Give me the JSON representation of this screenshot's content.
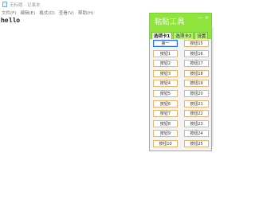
{
  "notepad": {
    "title": "无标题 - 记事本",
    "menu": [
      "文件(F)",
      "编辑(E)",
      "格式(O)",
      "查看(V)",
      "帮助(H)"
    ],
    "content": "hello"
  },
  "tool": {
    "title": "粘贴工具",
    "controls": [
      "—",
      "×"
    ],
    "tabs": [
      "选项卡1",
      "选项卡2",
      "设置"
    ],
    "buttons": [
      "第一",
      "按钮15",
      "按钮1",
      "按钮16",
      "按钮2",
      "按钮17",
      "按钮3",
      "按钮18",
      "按钮4",
      "按钮19",
      "按钮5",
      "按钮20",
      "按钮6",
      "按钮21",
      "按钮7",
      "按钮22",
      "按钮8",
      "按钮23",
      "按钮9",
      "按钮24",
      "按钮10",
      "按钮25"
    ]
  }
}
